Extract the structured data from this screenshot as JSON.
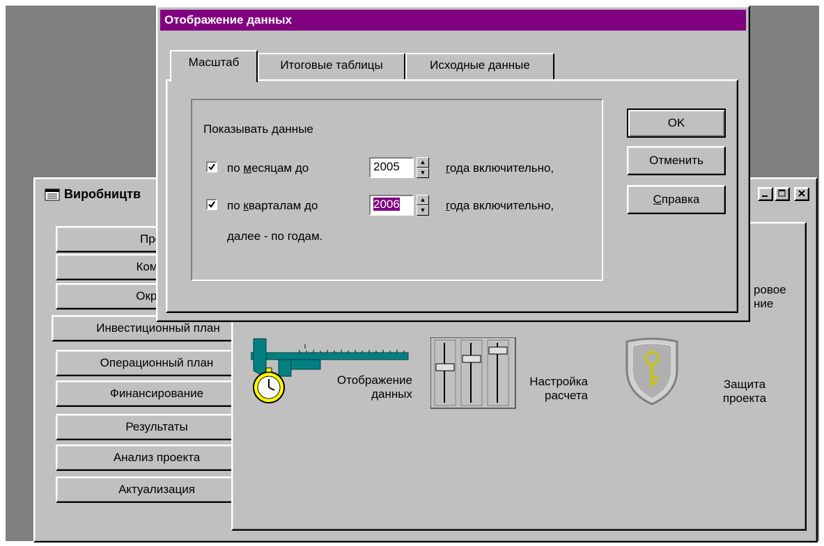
{
  "project_window": {
    "title": "Виробництв",
    "nav": [
      {
        "label": "Проек"
      },
      {
        "label": "Компан"
      },
      {
        "label": "Окруже"
      },
      {
        "label": "Инвестиционный план"
      },
      {
        "label": "Операционный план"
      },
      {
        "label": "Финансирование"
      },
      {
        "label": "Результаты"
      },
      {
        "label": "Анализ проекта"
      },
      {
        "label": "Актуализация"
      }
    ],
    "tools": {
      "partial_line1": "ровое",
      "partial_line2": "ние",
      "display_line1": "Отображение",
      "display_line2": "данных",
      "calc_line1": "Настройка",
      "calc_line2": "расчета",
      "protect_line1": "Защита",
      "protect_line2": "проекта"
    }
  },
  "dialog": {
    "title": "Отображение данных",
    "tabs": [
      {
        "label": "Масштаб",
        "active": true
      },
      {
        "label": "Итоговые таблицы",
        "active": false
      },
      {
        "label": "Исходные данные",
        "active": false
      }
    ],
    "group_label": "Показывать данные",
    "row1": {
      "checked": true,
      "pre": "по ",
      "u": "м",
      "post": "есяцам до",
      "value": "2005",
      "tail_u": "г",
      "tail": "ода включительно,"
    },
    "row2": {
      "checked": true,
      "pre": "по ",
      "u": "к",
      "post": "варталам до",
      "value": "2006",
      "tail_u": "г",
      "tail": "ода включительно,"
    },
    "footer": "далее - по годам.",
    "buttons": {
      "ok": "OK",
      "cancel": "Отменить",
      "help_u": "С",
      "help": "правка"
    }
  },
  "colors": {
    "face": "#c0c0c0",
    "desktop": "#808080",
    "titlebar": "#800080",
    "selection": "#800080"
  }
}
